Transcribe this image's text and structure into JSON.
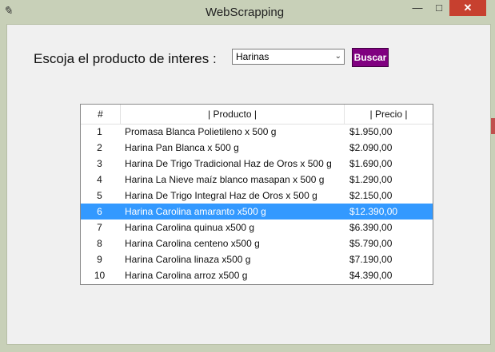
{
  "window": {
    "title": "WebScrapping",
    "minimize": "—",
    "maximize": "□",
    "close": "✕"
  },
  "form": {
    "prompt": "Escoja el producto de interes :",
    "selected_product": "Harinas",
    "search_label": "Buscar"
  },
  "table": {
    "headers": [
      "#",
      "| Producto |",
      "| Precio |"
    ],
    "selected_index": 5,
    "rows": [
      {
        "num": "1",
        "product": "Promasa Blanca Polietileno x 500 g",
        "price": "$1.950,00"
      },
      {
        "num": "2",
        "product": "Harina Pan Blanca x 500 g",
        "price": "$2.090,00"
      },
      {
        "num": "3",
        "product": "Harina De Trigo Tradicional Haz de Oros x 500 g",
        "price": "$1.690,00"
      },
      {
        "num": "4",
        "product": "Harina La Nieve maíz blanco masapan x 500 g",
        "price": "$1.290,00"
      },
      {
        "num": "5",
        "product": "Harina De Trigo Integral Haz de Oros x 500 g",
        "price": "$2.150,00"
      },
      {
        "num": "6",
        "product": "Harina Carolina amaranto x500 g",
        "price": "$12.390,00"
      },
      {
        "num": "7",
        "product": "Harina Carolina quinua x500 g",
        "price": "$6.390,00"
      },
      {
        "num": "8",
        "product": "Harina Carolina centeno x500 g",
        "price": "$5.790,00"
      },
      {
        "num": "9",
        "product": "Harina Carolina linaza x500 g",
        "price": "$7.190,00"
      },
      {
        "num": "10",
        "product": "Harina Carolina arroz x500 g",
        "price": "$4.390,00"
      }
    ]
  },
  "colors": {
    "accent_button": "#800080",
    "selection": "#3399ff",
    "close_button": "#c7402f"
  }
}
